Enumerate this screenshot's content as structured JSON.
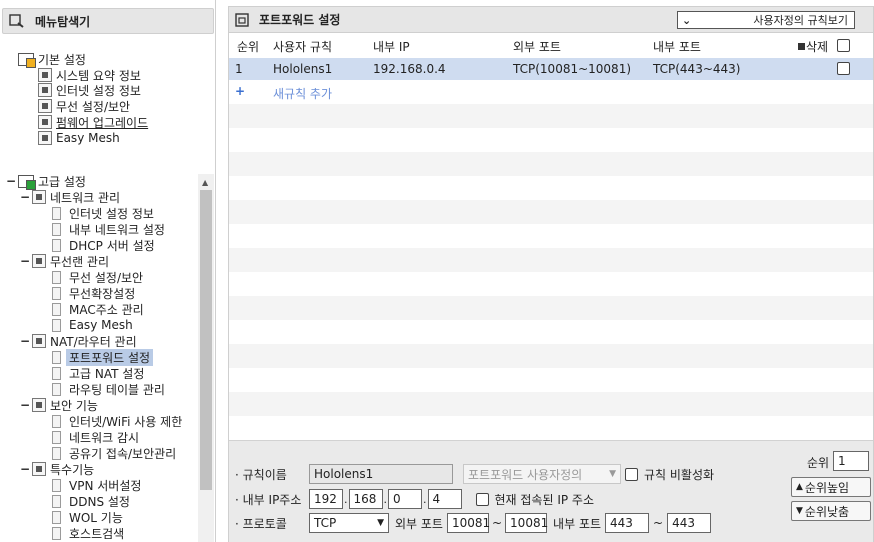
{
  "left": {
    "title": "메뉴탐색기",
    "basic": {
      "label": "기본 설정",
      "items": [
        "시스템 요약 정보",
        "인터넷 설정 정보",
        "무선 설정/보안",
        "펌웨어 업그레이드",
        "Easy Mesh"
      ]
    },
    "advanced": {
      "label": "고급 설정",
      "groups": [
        {
          "label": "네트워크 관리",
          "items": [
            "인터넷 설정 정보",
            "내부 네트워크 설정",
            "DHCP 서버 설정"
          ]
        },
        {
          "label": "무선랜 관리",
          "items": [
            "무선 설정/보안",
            "무선확장설정",
            "MAC주소 관리",
            "Easy Mesh"
          ]
        },
        {
          "label": "NAT/라우터 관리",
          "items": [
            "포트포워드 설정",
            "고급 NAT 설정",
            "라우팅 테이블 관리"
          ]
        },
        {
          "label": "보안 기능",
          "items": [
            "인터넷/WiFi 사용 제한",
            "네트워크 감시",
            "공유기 접속/보안관리"
          ]
        },
        {
          "label": "특수기능",
          "items": [
            "VPN 서버설정",
            "DDNS 설정",
            "WOL 기능",
            "호스트검색"
          ]
        }
      ]
    }
  },
  "right": {
    "title": "포트포워드 설정",
    "view_select": "사용자정의 규칙보기",
    "headers": {
      "num": "순위",
      "rule": "사용자 규칙",
      "ip": "내부 IP",
      "ext": "외부 포트",
      "int": "내부 포트",
      "del": "삭제"
    },
    "rows": [
      {
        "num": "1",
        "rule": "Hololens1",
        "ip": "192.168.0.4",
        "ext": "TCP(10081~10081)",
        "int": "TCP(443~443)"
      }
    ],
    "add_plus": "+",
    "add_label": "새규칙 추가"
  },
  "form": {
    "rule_name_label": "규칙이름",
    "rule_name_value": "Hololens1",
    "preset_select": "포트포워드 사용자정의",
    "disable_label": "규칙 비활성화",
    "ip_label": "내부 IP주소",
    "ip": [
      "192",
      "168",
      "0",
      "4"
    ],
    "current_ip_label": "현재 접속된 IP 주소",
    "proto_label": "프로토콜",
    "proto_value": "TCP",
    "ext_port_label": "외부 포트",
    "ext_from": "10081",
    "ext_to": "10081",
    "int_port_label": "내부 포트",
    "int_from": "443",
    "int_to": "443",
    "tilde": "~",
    "rank_label": "순위",
    "rank_value": "1",
    "rank_up": "순위높임",
    "rank_down": "순위낮춤"
  }
}
